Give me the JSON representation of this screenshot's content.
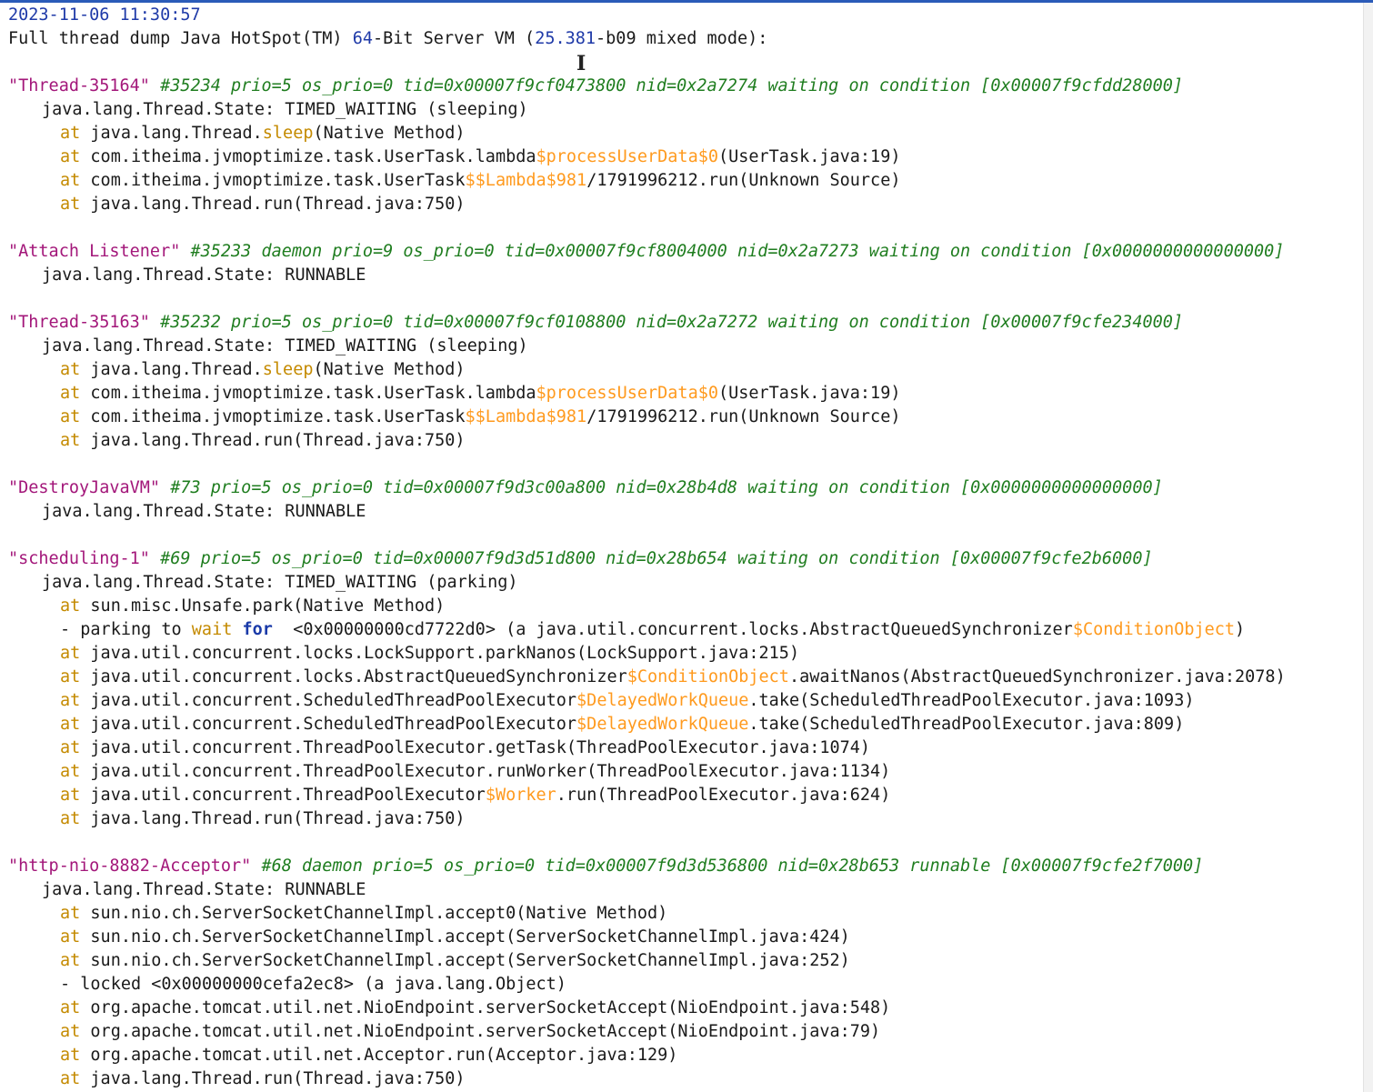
{
  "header": {
    "timestamp": "2023-11-06 11:30:57",
    "vm_prefix": "Full thread dump Java HotSpot(TM) ",
    "vm_bits": "64",
    "vm_mid": "-Bit Server VM (",
    "vm_ver": "25.381",
    "vm_suffix": "-b09 mixed mode):"
  },
  "threads": [
    {
      "name": "\"Thread-35164\"",
      "meta": " #35234 prio=5 os_prio=0 tid=0x00007f9cf0473800 nid=0x2a7274 waiting on condition [0x00007f9cfdd28000]",
      "state": "java.lang.Thread.State: TIMED_WAITING (sleeping)",
      "frames": [
        [
          "java.lang.Thread.",
          "sleep",
          "(Native Method)"
        ],
        [
          "com.itheima.jvmoptimize.task.UserTask.lambda",
          "$processUserData$0",
          "(UserTask.java:19)"
        ],
        [
          "com.itheima.jvmoptimize.task.UserTask",
          "$$Lambda$981",
          "/1791996212.run(Unknown Source)"
        ],
        [
          "java.lang.Thread.run(Thread.java:750)"
        ]
      ]
    },
    {
      "name": "\"Attach Listener\"",
      "meta": " #35233 daemon prio=9 os_prio=0 tid=0x00007f9cf8004000 nid=0x2a7273 waiting on condition [0x0000000000000000]",
      "state": "java.lang.Thread.State: RUNNABLE"
    },
    {
      "name": "\"Thread-35163\"",
      "meta": " #35232 prio=5 os_prio=0 tid=0x00007f9cf0108800 nid=0x2a7272 waiting on condition [0x00007f9cfe234000]",
      "state": "java.lang.Thread.State: TIMED_WAITING (sleeping)",
      "frames": [
        [
          "java.lang.Thread.",
          "sleep",
          "(Native Method)"
        ],
        [
          "com.itheima.jvmoptimize.task.UserTask.lambda",
          "$processUserData$0",
          "(UserTask.java:19)"
        ],
        [
          "com.itheima.jvmoptimize.task.UserTask",
          "$$Lambda$981",
          "/1791996212.run(Unknown Source)"
        ],
        [
          "java.lang.Thread.run(Thread.java:750)"
        ]
      ]
    },
    {
      "name": "\"DestroyJavaVM\"",
      "meta": " #73 prio=5 os_prio=0 tid=0x00007f9d3c00a800 nid=0x28b4d8 waiting on condition [0x0000000000000000]",
      "state": "java.lang.Thread.State: RUNNABLE"
    },
    {
      "name": "\"scheduling-1\"",
      "meta": " #69 prio=5 os_prio=0 tid=0x00007f9d3d51d800 nid=0x28b654 waiting on condition [0x00007f9cfe2b6000]",
      "state": "java.lang.Thread.State: TIMED_WAITING (parking)",
      "frames": [
        [
          "sun.misc.Unsafe.park(Native Method)"
        ],
        [
          "java.util.concurrent.locks.LockSupport.parkNanos(LockSupport.java:215)"
        ],
        [
          "java.util.concurrent.locks.AbstractQueuedSynchronizer",
          "$ConditionObject",
          ".awaitNanos(AbstractQueuedSynchronizer.java:2078)"
        ],
        [
          "java.util.concurrent.ScheduledThreadPoolExecutor",
          "$DelayedWorkQueue",
          ".take(ScheduledThreadPoolExecutor.java:1093)"
        ],
        [
          "java.util.concurrent.ScheduledThreadPoolExecutor",
          "$DelayedWorkQueue",
          ".take(ScheduledThreadPoolExecutor.java:809)"
        ],
        [
          "java.util.concurrent.ThreadPoolExecutor.getTask(ThreadPoolExecutor.java:1074)"
        ],
        [
          "java.util.concurrent.ThreadPoolExecutor.runWorker(ThreadPoolExecutor.java:1134)"
        ],
        [
          "java.util.concurrent.ThreadPoolExecutor",
          "$Worker",
          ".run(ThreadPoolExecutor.java:624)"
        ],
        [
          "java.lang.Thread.run(Thread.java:750)"
        ]
      ],
      "lock": {
        "prefix": "- parking to ",
        "w1": "wait",
        "w2": "for",
        "addr": "  <0x00000000cd7722d0> (a java.util.concurrent.locks.AbstractQueuedSynchronizer",
        "inner": "$ConditionObject",
        "end": ")"
      }
    },
    {
      "name": "\"http-nio-8882-Acceptor\"",
      "meta": " #68 daemon prio=5 os_prio=0 tid=0x00007f9d3d536800 nid=0x28b653 runnable [0x00007f9cfe2f7000]",
      "state": "java.lang.Thread.State: RUNNABLE",
      "frames": [
        [
          "sun.nio.ch.ServerSocketChannelImpl.accept0(Native Method)"
        ],
        [
          "sun.nio.ch.ServerSocketChannelImpl.accept(ServerSocketChannelImpl.java:424)"
        ],
        [
          "sun.nio.ch.ServerSocketChannelImpl.accept(ServerSocketChannelImpl.java:252)"
        ],
        [
          "org.apache.tomcat.util.net.NioEndpoint.serverSocketAccept(NioEndpoint.java:548)"
        ],
        [
          "org.apache.tomcat.util.net.NioEndpoint.serverSocketAccept(NioEndpoint.java:79)"
        ],
        [
          "org.apache.tomcat.util.net.Acceptor.run(Acceptor.java:129)"
        ],
        [
          "java.lang.Thread.run(Thread.java:750)"
        ]
      ],
      "lock": {
        "prefix": "- locked ",
        "addr": "<0x00000000cefa2ec8> (a java.lang.Object)"
      }
    }
  ],
  "at_kw": "at"
}
